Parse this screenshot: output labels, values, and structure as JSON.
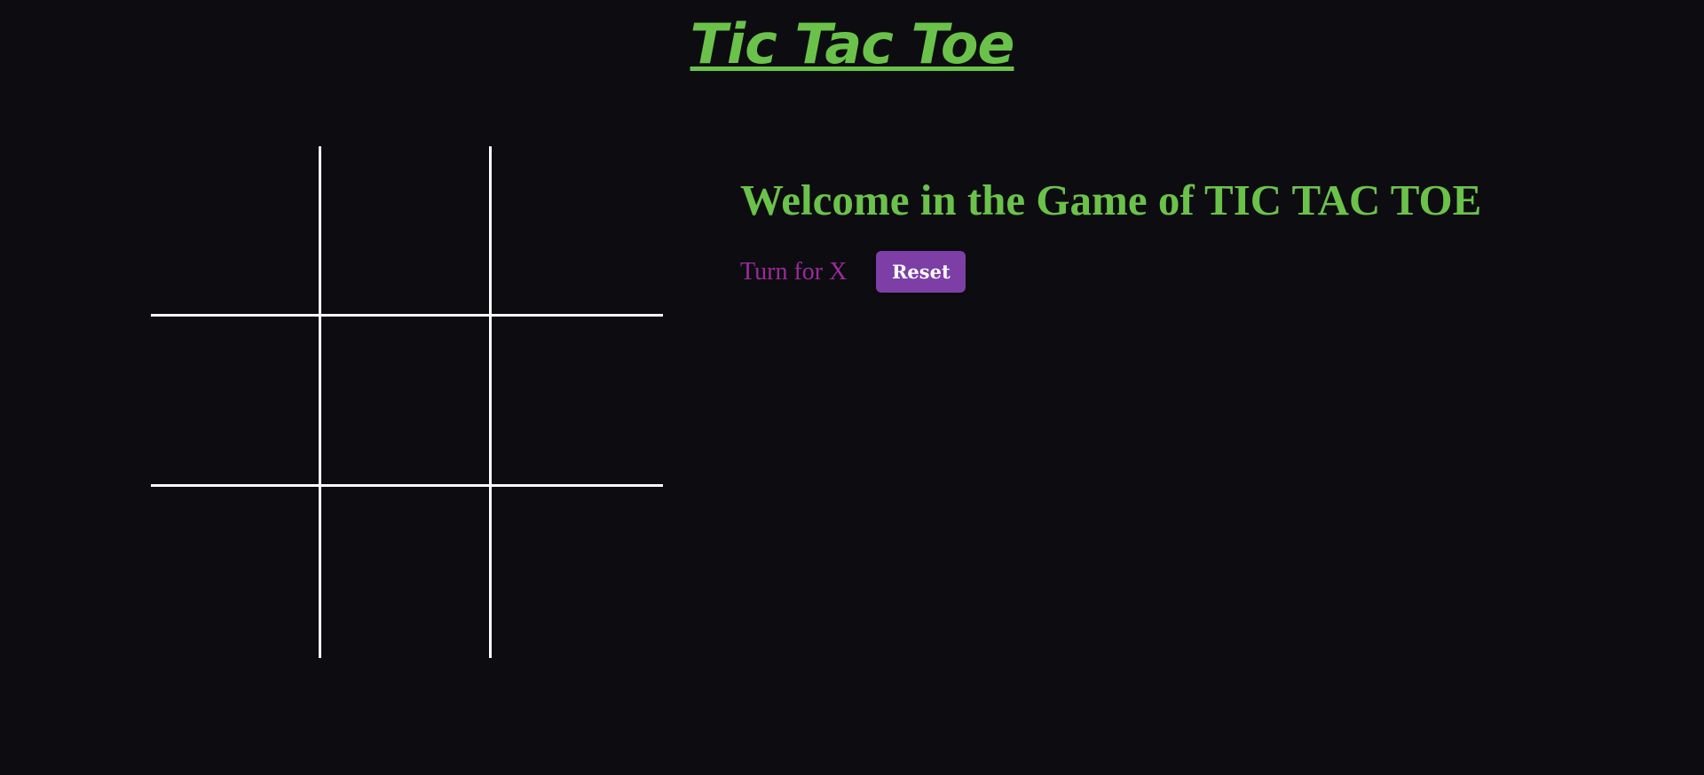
{
  "header": {
    "title": "Tic Tac Toe"
  },
  "board": {
    "cells": [
      "",
      "",
      "",
      "",
      "",
      "",
      "",
      "",
      ""
    ]
  },
  "info": {
    "welcome_text": "Welcome in the Game of TIC TAC TOE",
    "turn_text": "Turn for X",
    "reset_label": "Reset"
  },
  "colors": {
    "background": "#0d0c11",
    "title_green": "#6bc24a",
    "grid_lines": "#ffffff",
    "turn_text_purple": "#9b2b9c",
    "reset_button": "#7d3fa6"
  }
}
